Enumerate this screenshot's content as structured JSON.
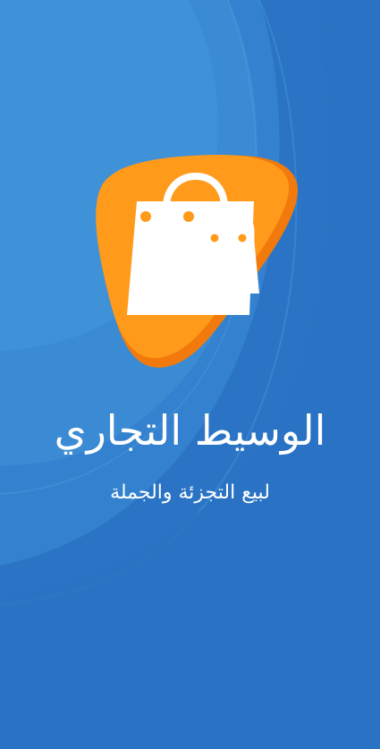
{
  "app": {
    "title": "الوسيط التجاري",
    "subtitle": "لبيع التجزئة والجملة"
  },
  "logo": {
    "icon": "shopping-bags-icon",
    "badge_color": "#ff9a1a",
    "badge_shadow_color": "#f27a0c",
    "bag_color": "#ffffff"
  },
  "colors": {
    "background": "#2d78c8",
    "background_light": "#3b88d2",
    "background_dark": "#266cbf",
    "text": "#ffffff"
  }
}
